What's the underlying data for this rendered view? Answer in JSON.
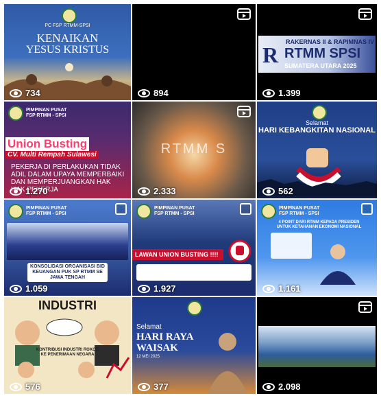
{
  "posts": [
    {
      "title_line1": "KENAIKAN",
      "title_line2": "YESUS KRISTUS",
      "org": "PC FSP RTMM-SPSI",
      "views": "734"
    },
    {
      "views": "894",
      "type": "reel"
    },
    {
      "title_line1": "RAKERNAS II & RAPIMNAS IV",
      "title_big": "RTMM SPSI",
      "subtitle": "SUMATERA UTARA 2025",
      "views": "1.399",
      "type": "reel"
    },
    {
      "org": "PIMPINAN PUSAT FSP RTMM - SPSI",
      "title": "Union Busting",
      "subtitle": "CV. Multi Rempah Sulawesi",
      "body": "PEKERJA DI PERLAKUKAN TIDAK ADIL DALAM UPAYA MEMPERBAIKI DAN MEMPERJUANGKAN HAK HAK PEKERJA",
      "views": "1.270"
    },
    {
      "overlay_text": "RTMM S",
      "views": "2.333",
      "type": "reel"
    },
    {
      "greeting": "Selamat",
      "title": "HARI KEBANGKITAN NASIONAL",
      "views": "562"
    },
    {
      "org": "PIMPINAN PUSAT FSP RTMM - SPSI",
      "caption": "KONSOLIDASI ORGANISASI BID KEUANGAN PUK SP RTMM SE JAWA TENGAH",
      "views": "1.059"
    },
    {
      "org": "PIMPINAN PUSAT FSP RTMM - SPSI",
      "banner": "LAWAN UNION BUSTING !!!!",
      "views": "1.927"
    },
    {
      "org": "PIMPINAN PUSAT FSP RTMM - SPSI",
      "headline": "4 POINT DARI RTMM KEPADA PRESIDEN UNTUK KETAHANAN EKONOMI NASIONAL",
      "views": "1.161"
    },
    {
      "title": "INDUSTRI",
      "caption": "KONTRIBUSI INDUSTRI ROKOK KE PENERIMAAN NEGARA",
      "views": "576"
    },
    {
      "greeting": "Selamat",
      "title_line1": "HARI RAYA",
      "title_line2": "WAISAK",
      "date": "12 MEI 2025",
      "views": "377"
    },
    {
      "views": "2.098",
      "type": "reel"
    }
  ],
  "colors": {
    "navy": "#1c2c6e",
    "red": "#c8102e",
    "blue": "#1f6fd1",
    "cream": "#f3e6c4"
  }
}
